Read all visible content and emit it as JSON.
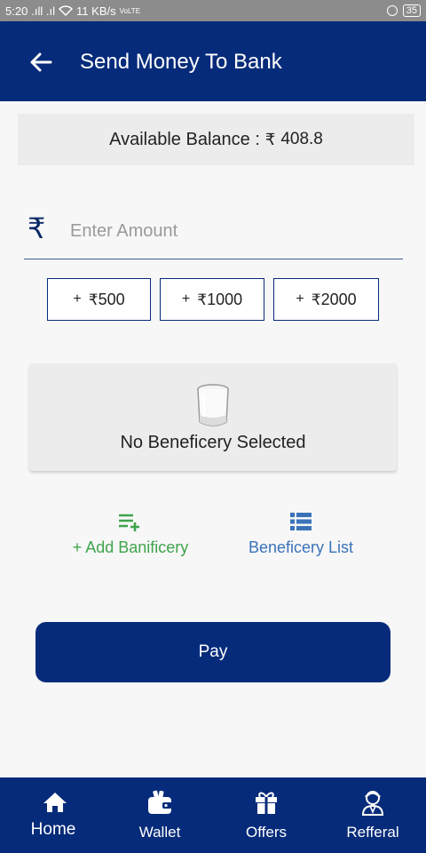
{
  "status_bar": {
    "time": "5:20",
    "signal": ".ıll .ıl",
    "speed": "11 KB/s",
    "network": "VoLTE",
    "battery": "35"
  },
  "header": {
    "title": "Send Money To Bank",
    "back_icon": "arrow-left-icon"
  },
  "balance": {
    "label": "Available Balance :",
    "currency": "₹",
    "value": "408.8"
  },
  "amount": {
    "currency_icon": "₹",
    "placeholder": "Enter Amount",
    "value": ""
  },
  "quick_amounts": [
    {
      "plus": "+",
      "currency": "₹",
      "value": "500"
    },
    {
      "plus": "+",
      "currency": "₹",
      "value": "1000"
    },
    {
      "plus": "+",
      "currency": "₹",
      "value": "2000"
    }
  ],
  "beneficiary": {
    "empty_icon": "glass-icon",
    "empty_text": "No Beneficery Selected"
  },
  "actions": {
    "add": {
      "label": "+ Add Banificery",
      "icon": "playlist-add-icon",
      "color": "#3fa34d"
    },
    "list": {
      "label": "Beneficery List",
      "icon": "list-icon",
      "color": "#3b73b9"
    }
  },
  "pay_button": {
    "label": "Pay"
  },
  "bottom_nav": [
    {
      "label": "Home",
      "icon": "home-icon",
      "active": true
    },
    {
      "label": "Wallet",
      "icon": "wallet-icon",
      "active": false
    },
    {
      "label": "Offers",
      "icon": "gift-icon",
      "active": false
    },
    {
      "label": "Refferal",
      "icon": "agent-icon",
      "active": false
    }
  ],
  "colors": {
    "primary": "#062b7a",
    "status_bar": "#8c8c8c",
    "background": "#f7f7f7",
    "card": "#ececec"
  }
}
